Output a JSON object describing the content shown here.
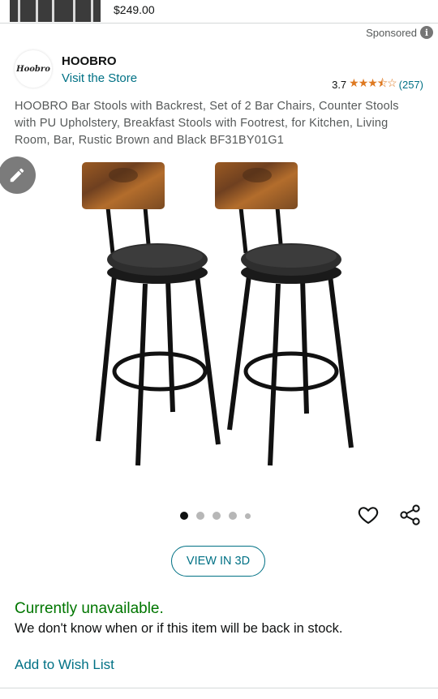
{
  "previous_item": {
    "price": "$249.00"
  },
  "ad": {
    "sponsored_label": "Sponsored",
    "info_icon": "info-icon"
  },
  "brand": {
    "logo_text": "Hoobro",
    "name": "HOOBRO",
    "visit_store": "Visit the Store",
    "rating": "3.7",
    "stars": "★★★⯪☆",
    "review_count": "(257)"
  },
  "product": {
    "title": "HOOBRO Bar Stools with Backrest, Set of 2 Bar Chairs, Counter Stools with PU Upholstery, Breakfast Stools with Footrest, for Kitchen, Living Room, Bar, Rustic Brown and Black BF31BY01G1",
    "image_count": 5,
    "active_image": 1,
    "view_3d_label": "VIEW IN 3D",
    "availability": "Currently unavailable.",
    "stock_note": "We don't know when or if this item will be back in stock.",
    "add_to_wish_list": "Add to Wish List"
  },
  "colors": {
    "link": "#007185",
    "available_green": "#007600",
    "star_orange": "#de7921",
    "text": "#0f1111",
    "muted_text": "#565959"
  }
}
